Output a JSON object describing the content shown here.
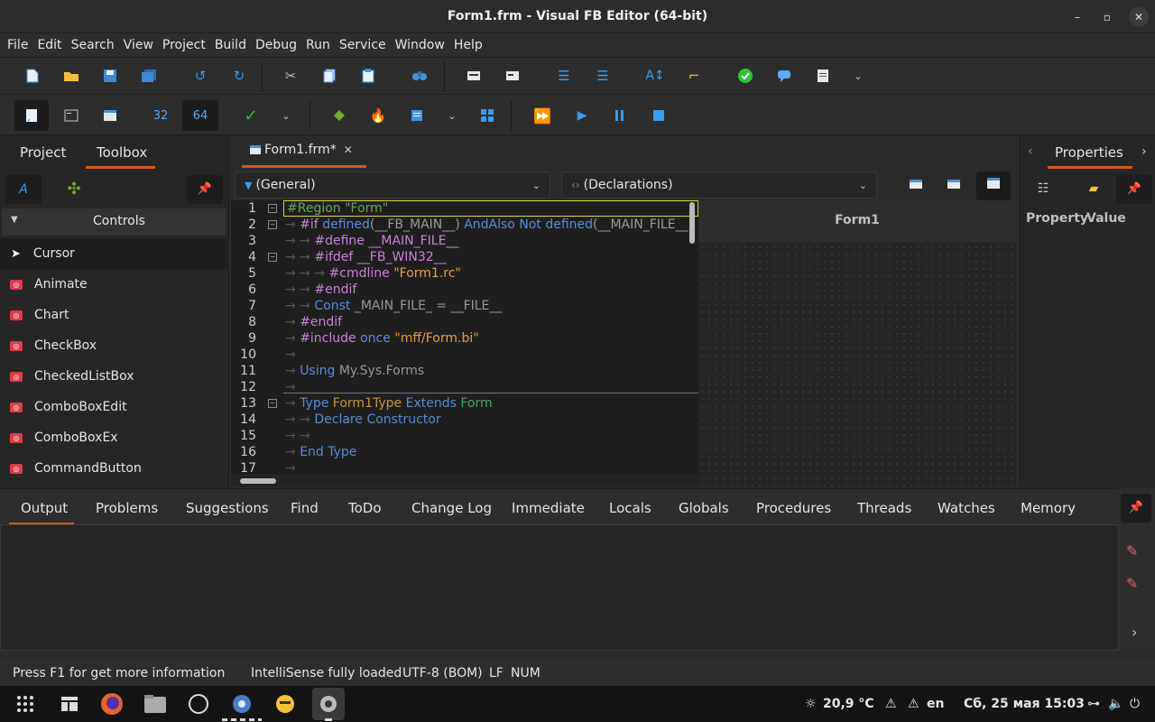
{
  "window": {
    "title": "Form1.frm - Visual FB Editor (64-bit)"
  },
  "menu": [
    "File",
    "Edit",
    "Search",
    "View",
    "Project",
    "Build",
    "Debug",
    "Run",
    "Service",
    "Window",
    "Help"
  ],
  "toolbar2": {
    "bit32": "32",
    "bit64": "64"
  },
  "left_panel": {
    "tabs": [
      "Project",
      "Toolbox"
    ],
    "group": "Controls",
    "controls": [
      "Cursor",
      "Animate",
      "Chart",
      "CheckBox",
      "CheckedListBox",
      "ComboBoxEdit",
      "ComboBoxEx",
      "CommandButton"
    ]
  },
  "editor": {
    "tab_label": "Form1.frm*",
    "combo_left": "(General)",
    "combo_right": "(Declarations)",
    "line_numbers": [
      "1",
      "2",
      "3",
      "4",
      "5",
      "6",
      "7",
      "8",
      "9",
      "10",
      "11",
      "12",
      "13",
      "14",
      "15",
      "16",
      "17"
    ],
    "code": {
      "l1": "#Region \"Form\"",
      "l2_if": "#if",
      "l2_def1": "defined",
      "l2_arg1": "(__FB_MAIN__)",
      "l2_andalso": "AndAlso",
      "l2_not": "Not",
      "l2_def2": "defined",
      "l2_arg2": "(__MAIN_FILE__",
      "l3": "#define __MAIN_FILE__",
      "l4": "#ifdef __FB_WIN32__",
      "l5_cmd": "#cmdline",
      "l5_str": "\"Form1.rc\"",
      "l6": "#endif",
      "l7_const": "Const",
      "l7_name": "_MAIN_FILE_",
      "l7_eq": "=",
      "l7_val": "__FILE__",
      "l8": "#endif",
      "l9_inc": "#include",
      "l9_once": "once",
      "l9_str": "\"mff/Form.bi\"",
      "l11_using": "Using",
      "l11_ns": "My.Sys.Forms",
      "l13_type": "Type",
      "l13_name": "Form1Type",
      "l13_ext": "Extends",
      "l13_base": "Form",
      "l14_decl": "Declare",
      "l14_ctor": "Constructor",
      "l16": "End Type"
    }
  },
  "designer": {
    "form_caption": "Form1"
  },
  "properties": {
    "title": "Properties",
    "col_property": "Property",
    "col_value": "Value"
  },
  "bottom_tabs": [
    "Output",
    "Problems",
    "Suggestions",
    "Find",
    "ToDo",
    "Change Log",
    "Immediate",
    "Locals",
    "Globals",
    "Procedures",
    "Threads",
    "Watches",
    "Memory"
  ],
  "status": {
    "hint": "Press F1 for get more information",
    "intellisense": "IntelliSense fully loaded",
    "encoding": "UTF-8 (BOM)",
    "eol": "LF",
    "num": "NUM"
  },
  "taskbar": {
    "weather": "20,9 °C",
    "lang": "en",
    "datetime": "Сб, 25 мая  15:03"
  },
  "colors": {
    "accent": "#d55a1b",
    "control_icon": "#e03a4c",
    "play": "#3a9cf0"
  }
}
